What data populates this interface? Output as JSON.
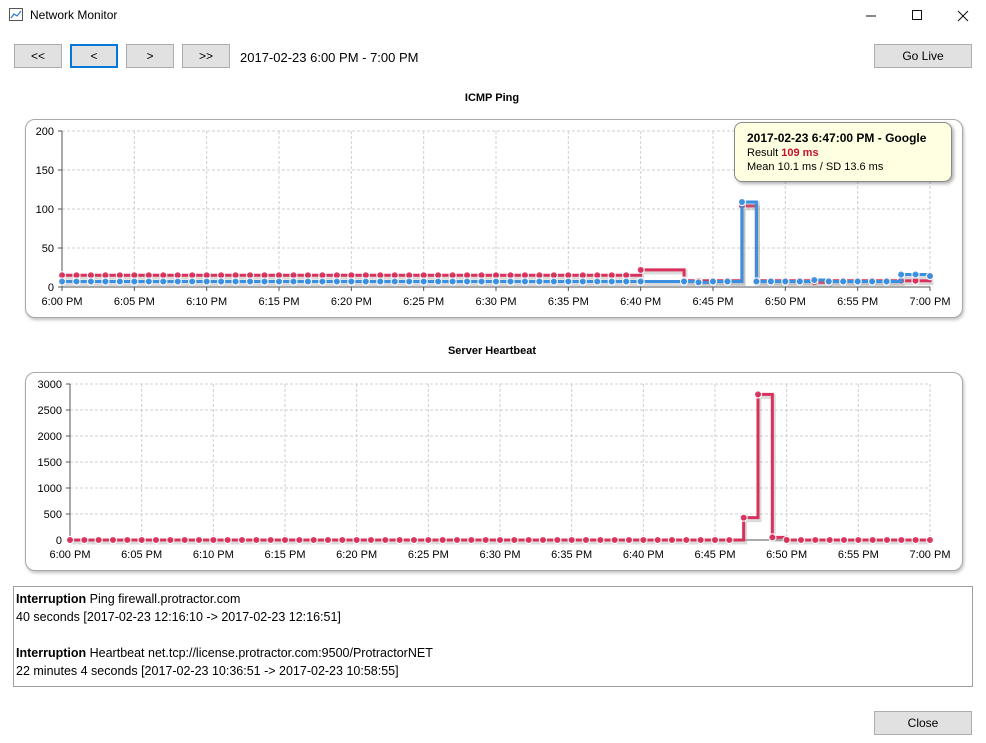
{
  "window": {
    "title": "Network Monitor",
    "min_icon": "minimize-icon",
    "max_icon": "maximize-icon",
    "close_icon": "close-icon"
  },
  "nav": {
    "first": "<<",
    "prev": "<",
    "next": ">",
    "last": ">>",
    "range": "2017-02-23 6:00 PM - 7:00 PM",
    "go_live": "Go Live"
  },
  "colors": {
    "red": "#d8315b",
    "blue": "#3b8fe0",
    "grid": "#cfcfcf"
  },
  "chart_data": [
    {
      "type": "line",
      "title": "ICMP Ping",
      "x_ticks": [
        "6:00 PM",
        "6:05 PM",
        "6:10 PM",
        "6:15 PM",
        "6:20 PM",
        "6:25 PM",
        "6:30 PM",
        "6:35 PM",
        "6:40 PM",
        "6:45 PM",
        "6:50 PM",
        "6:55 PM",
        "7:00 PM"
      ],
      "y_ticks": [
        "200",
        "150",
        "100",
        "50",
        "0"
      ],
      "xlim": [
        0,
        60
      ],
      "ylim": [
        0,
        200
      ],
      "grid": true,
      "series": [
        {
          "name": "Google",
          "color": "#d8315b",
          "x": [
            0,
            1,
            2,
            3,
            4,
            5,
            6,
            7,
            8,
            9,
            10,
            11,
            12,
            13,
            14,
            15,
            16,
            17,
            18,
            19,
            20,
            21,
            22,
            23,
            24,
            25,
            26,
            27,
            28,
            29,
            30,
            31,
            32,
            33,
            34,
            35,
            36,
            37,
            38,
            39,
            40,
            43,
            44,
            45,
            46,
            47,
            48,
            49,
            50,
            51,
            52,
            53,
            54,
            55,
            56,
            57,
            58,
            59,
            60
          ],
          "y": [
            15,
            15,
            15,
            15,
            15,
            15,
            15,
            15,
            15,
            15,
            15,
            15,
            15,
            15,
            15,
            15,
            15,
            15,
            15,
            15,
            15,
            15,
            15,
            15,
            15,
            15,
            15,
            15,
            15,
            15,
            15,
            15,
            15,
            15,
            15,
            15,
            15,
            15,
            15,
            15,
            22,
            8,
            8,
            8,
            8,
            104,
            8,
            8,
            8,
            8,
            6,
            8,
            8,
            8,
            8,
            8,
            8,
            8,
            15
          ]
        },
        {
          "name": "",
          "color": "#3b8fe0",
          "x": [
            0,
            1,
            2,
            3,
            4,
            5,
            6,
            7,
            8,
            9,
            10,
            11,
            12,
            13,
            14,
            15,
            16,
            17,
            18,
            19,
            20,
            21,
            22,
            23,
            24,
            25,
            26,
            27,
            28,
            29,
            30,
            31,
            32,
            33,
            34,
            35,
            36,
            37,
            38,
            39,
            40,
            43,
            44,
            45,
            46,
            47,
            48,
            49,
            50,
            51,
            52,
            53,
            54,
            55,
            56,
            57,
            58,
            59,
            60
          ],
          "y": [
            7,
            7,
            7,
            7,
            7,
            7,
            7,
            7,
            7,
            7,
            7,
            7,
            7,
            7,
            7,
            7,
            7,
            7,
            7,
            7,
            7,
            7,
            7,
            7,
            7,
            7,
            7,
            7,
            7,
            7,
            7,
            7,
            7,
            7,
            7,
            7,
            7,
            7,
            7,
            7,
            7,
            7,
            6,
            7,
            7,
            109,
            7,
            7,
            7,
            7,
            9,
            7,
            7,
            7,
            7,
            7,
            16,
            16,
            14
          ]
        }
      ]
    },
    {
      "type": "line",
      "title": "Server Heartbeat",
      "x_ticks": [
        "6:00 PM",
        "6:05 PM",
        "6:10 PM",
        "6:15 PM",
        "6:20 PM",
        "6:25 PM",
        "6:30 PM",
        "6:35 PM",
        "6:40 PM",
        "6:45 PM",
        "6:50 PM",
        "6:55 PM",
        "7:00 PM"
      ],
      "y_ticks": [
        "3000",
        "2500",
        "2000",
        "1500",
        "1000",
        "500",
        "0"
      ],
      "xlim": [
        0,
        60
      ],
      "ylim": [
        0,
        3000
      ],
      "grid": true,
      "series": [
        {
          "name": "",
          "color": "#d8315b",
          "x": [
            0,
            1,
            2,
            3,
            4,
            5,
            6,
            7,
            8,
            9,
            10,
            11,
            12,
            13,
            14,
            15,
            16,
            17,
            18,
            19,
            20,
            21,
            22,
            23,
            24,
            25,
            26,
            27,
            28,
            29,
            30,
            31,
            32,
            33,
            34,
            35,
            36,
            37,
            38,
            39,
            40,
            41,
            42,
            43,
            44,
            45,
            46,
            47,
            48,
            49,
            50,
            51,
            52,
            53,
            54,
            55,
            56,
            57,
            58,
            59,
            60
          ],
          "y": [
            0,
            0,
            0,
            0,
            0,
            0,
            0,
            0,
            0,
            0,
            0,
            0,
            0,
            0,
            0,
            0,
            0,
            0,
            0,
            0,
            0,
            0,
            0,
            0,
            0,
            0,
            0,
            0,
            0,
            0,
            0,
            0,
            0,
            0,
            0,
            0,
            0,
            0,
            0,
            0,
            0,
            0,
            0,
            0,
            0,
            0,
            0,
            430,
            2800,
            50,
            0,
            0,
            0,
            0,
            0,
            0,
            0,
            0,
            0,
            0,
            0
          ]
        }
      ]
    }
  ],
  "tooltip": {
    "title": "2017-02-23 6:47:00 PM - Google",
    "result_label": "Result",
    "result_value": "109 ms",
    "stats": "Mean 10.1 ms / SD 13.6 ms"
  },
  "log": [
    {
      "kind": "Interruption",
      "target": "Ping firewall.protractor.com",
      "detail": "40 seconds [2017-02-23 12:16:10 -> 2017-02-23 12:16:51]"
    },
    {
      "kind": "Interruption",
      "target": "Heartbeat net.tcp://license.protractor.com:9500/ProtractorNET",
      "detail": "22 minutes 4 seconds [2017-02-23 10:36:51 -> 2017-02-23 10:58:55]"
    }
  ],
  "footer": {
    "close": "Close"
  }
}
